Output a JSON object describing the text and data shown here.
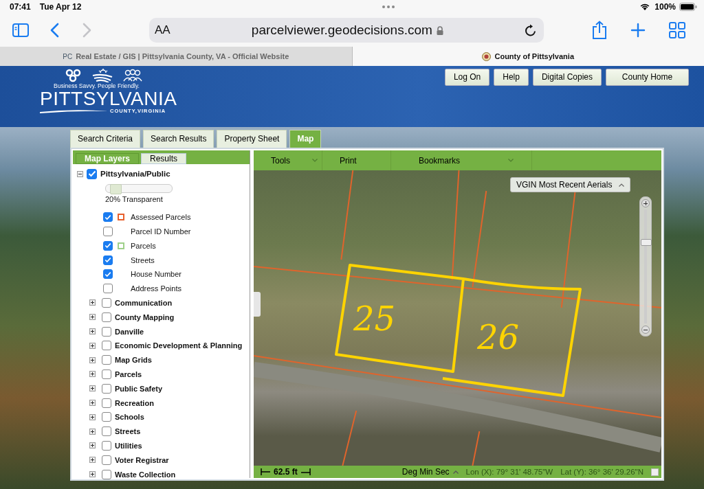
{
  "status_bar": {
    "time": "07:41",
    "date": "Tue Apr 12",
    "battery": "100%"
  },
  "browser": {
    "text_size": "AA",
    "url": "parcelviewer.geodecisions.com",
    "back_enabled": true,
    "forward_enabled": false,
    "tabs": [
      {
        "favicon": "PC",
        "title": "Real Estate / GIS | Pittsylvania County, VA - Official Website",
        "selected": false
      },
      {
        "title": "County of Pittsylvania",
        "selected": true
      }
    ]
  },
  "header": {
    "tagline": "Business Savvy. People Friendly.",
    "name": "PITTSYLVANIA",
    "subtitle": "COUNTY,VIRGINIA",
    "buttons": [
      "Log On",
      "Help",
      "Digital Copies",
      "County Home"
    ]
  },
  "main_tabs": [
    {
      "label": "Search Criteria",
      "selected": false
    },
    {
      "label": "Search Results",
      "selected": false
    },
    {
      "label": "Property Sheet",
      "selected": false
    },
    {
      "label": "Map",
      "selected": true
    }
  ],
  "panel_tabs": [
    {
      "label": "Map Layers",
      "selected": true
    },
    {
      "label": "Results",
      "selected": false
    }
  ],
  "layer_root": {
    "label": "Pittsylvania/Public",
    "checked": true,
    "expanded": true,
    "transparency": {
      "level": 0.08,
      "reading": "20% Transparent"
    },
    "children": [
      {
        "label": "Assessed Parcels",
        "checked": true,
        "color": "#e8602c"
      },
      {
        "label": "Parcel ID Number",
        "checked": false
      },
      {
        "label": "Parcels",
        "checked": true,
        "color": "#9fd08a"
      },
      {
        "label": "Streets",
        "checked": true
      },
      {
        "label": "House Number",
        "checked": true
      },
      {
        "label": "Address Points",
        "checked": false
      }
    ]
  },
  "layer_groups": [
    {
      "label": "Communication",
      "checked": false,
      "expanded": false
    },
    {
      "label": "County Mapping",
      "checked": false,
      "expanded": false
    },
    {
      "label": "Danville",
      "checked": false,
      "expanded": false
    },
    {
      "label": "Economic Development & Planning",
      "checked": false,
      "expanded": false
    },
    {
      "label": "Map Grids",
      "checked": false,
      "expanded": false
    },
    {
      "label": "Parcels",
      "checked": false,
      "expanded": false
    },
    {
      "label": "Public Safety",
      "checked": false,
      "expanded": false
    },
    {
      "label": "Recreation",
      "checked": false,
      "expanded": false
    },
    {
      "label": "Schools",
      "checked": false,
      "expanded": false
    },
    {
      "label": "Streets",
      "checked": false,
      "expanded": false
    },
    {
      "label": "Utilities",
      "checked": false,
      "expanded": false
    },
    {
      "label": "Voter Registrar",
      "checked": false,
      "expanded": false
    },
    {
      "label": "Waste Collection",
      "checked": false,
      "expanded": false
    }
  ],
  "map_toolbar": [
    {
      "label": "Tools",
      "dropdown": true
    },
    {
      "label": "Print",
      "dropdown": false
    },
    {
      "label": "Bookmarks",
      "dropdown": true
    }
  ],
  "map": {
    "basemap": "VGIN Most Recent Aerials",
    "zoom": {
      "level": 0.73
    },
    "annotations": [
      "25",
      "26"
    ],
    "scale": "62.5 ft",
    "coordinate_format": "Deg Min Sec",
    "lon": "Lon (X): 79° 31' 48.75\"W",
    "lat": "Lat (Y): 36° 36' 29.26\"N"
  }
}
